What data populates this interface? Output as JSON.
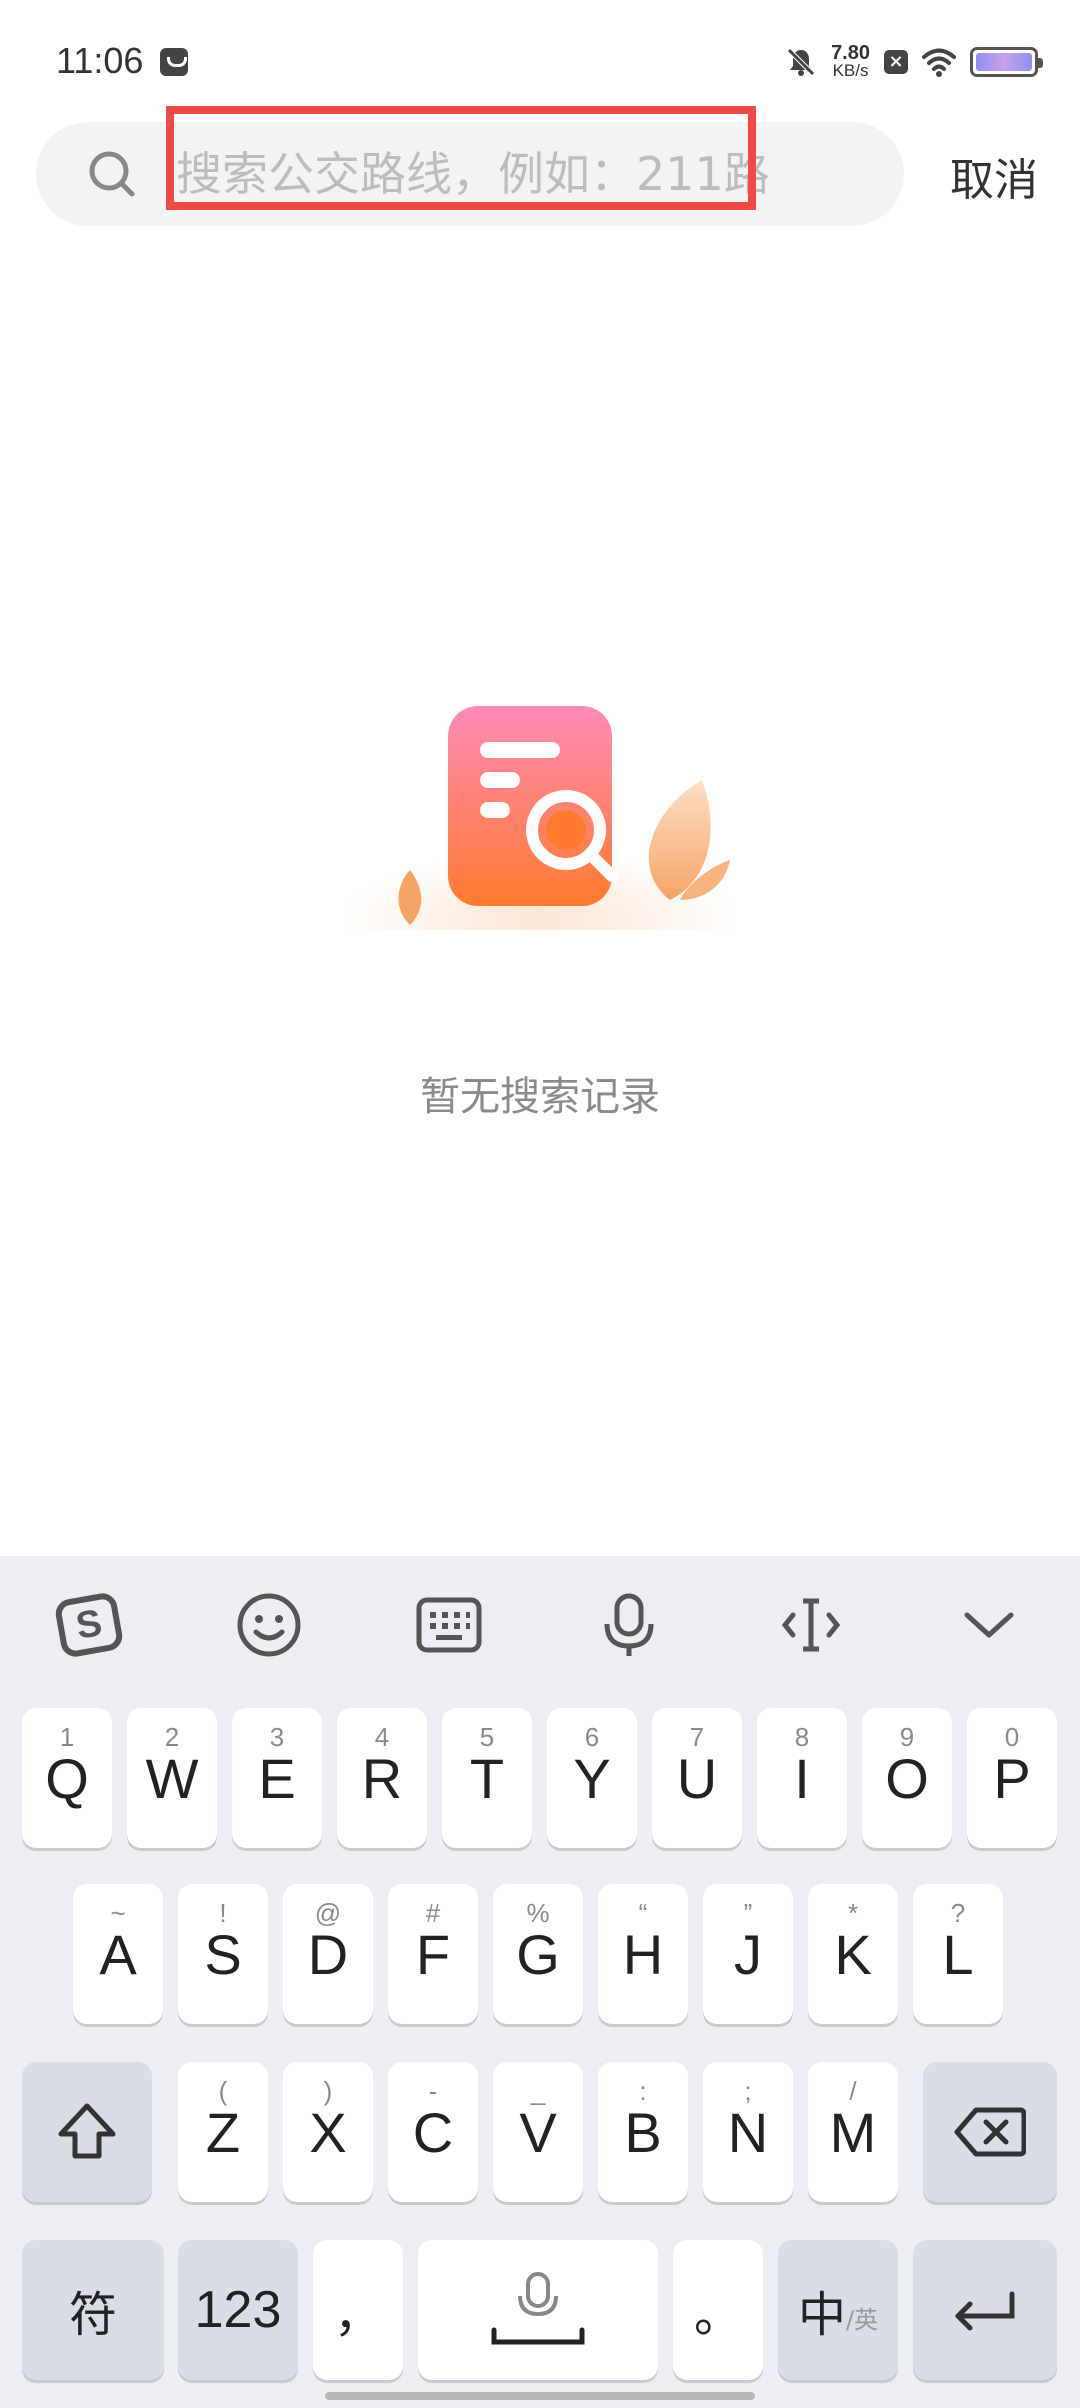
{
  "status_bar": {
    "time": "11:06",
    "net_speed_value": "7.80",
    "net_speed_unit": "KB/s",
    "icons": [
      "message-icon",
      "bell-off-icon",
      "close-box-icon",
      "wifi-icon",
      "battery-icon"
    ]
  },
  "search": {
    "placeholder": "搜索公交路线，例如：211路",
    "value": "",
    "cancel_label": "取消"
  },
  "empty_state": {
    "message": "暂无搜索记录"
  },
  "keyboard": {
    "toolbar_icons": [
      "sogou-logo-icon",
      "emoji-icon",
      "keyboard-icon",
      "microphone-icon",
      "cursor-icon",
      "chevron-down-icon"
    ],
    "row1": [
      {
        "main": "Q",
        "sub": "1"
      },
      {
        "main": "W",
        "sub": "2"
      },
      {
        "main": "E",
        "sub": "3"
      },
      {
        "main": "R",
        "sub": "4"
      },
      {
        "main": "T",
        "sub": "5"
      },
      {
        "main": "Y",
        "sub": "6"
      },
      {
        "main": "U",
        "sub": "7"
      },
      {
        "main": "I",
        "sub": "8"
      },
      {
        "main": "O",
        "sub": "9"
      },
      {
        "main": "P",
        "sub": "0"
      }
    ],
    "row2": [
      {
        "main": "A",
        "sub": "~"
      },
      {
        "main": "S",
        "sub": "!"
      },
      {
        "main": "D",
        "sub": "@"
      },
      {
        "main": "F",
        "sub": "#"
      },
      {
        "main": "G",
        "sub": "%"
      },
      {
        "main": "H",
        "sub": "“"
      },
      {
        "main": "J",
        "sub": "”"
      },
      {
        "main": "K",
        "sub": "*"
      },
      {
        "main": "L",
        "sub": "?"
      }
    ],
    "row3": [
      {
        "main": "Z",
        "sub": "("
      },
      {
        "main": "X",
        "sub": ")"
      },
      {
        "main": "C",
        "sub": "-"
      },
      {
        "main": "V",
        "sub": "_"
      },
      {
        "main": "B",
        "sub": ":"
      },
      {
        "main": "N",
        "sub": ";"
      },
      {
        "main": "M",
        "sub": "/"
      }
    ],
    "row4": {
      "symbols": "符",
      "numbers": "123",
      "comma": "，",
      "period": "。",
      "lang_main": "中",
      "lang_sub": "/英"
    }
  }
}
